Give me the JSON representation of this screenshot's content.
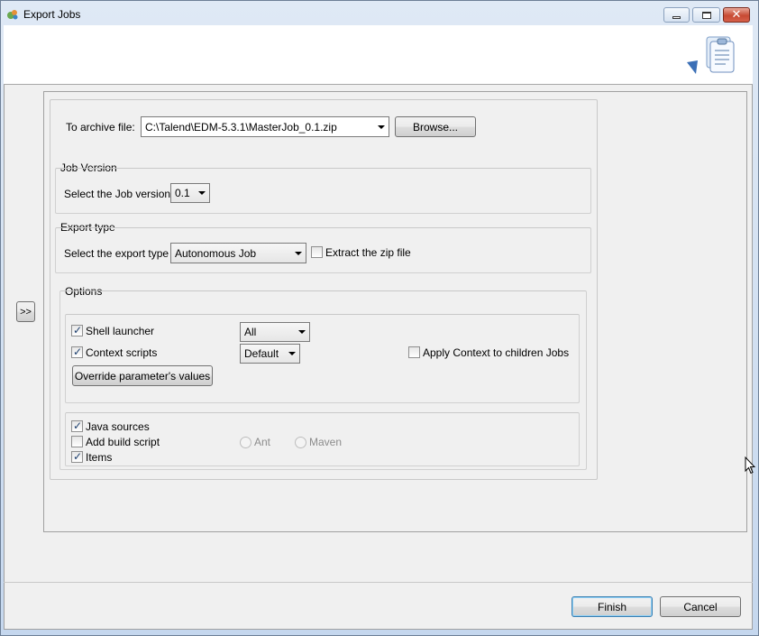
{
  "window": {
    "title": "Export Jobs"
  },
  "archive": {
    "label": "To archive file:",
    "path": "C:\\Talend\\EDM-5.3.1\\MasterJob_0.1.zip",
    "browse_label": "Browse..."
  },
  "job_version": {
    "group_title": "Job Version",
    "label": "Select the Job version",
    "value": "0.1"
  },
  "export_type": {
    "group_title": "Export type",
    "label": "Select the export type",
    "value": "Autonomous Job",
    "extract_label": "Extract the zip file",
    "extract_checked": false
  },
  "options": {
    "group_title": "Options",
    "shell_launcher_label": "Shell launcher",
    "shell_launcher_checked": true,
    "shell_launcher_value": "All",
    "context_scripts_label": "Context scripts",
    "context_scripts_checked": true,
    "context_scripts_value": "Default",
    "apply_context_label": "Apply Context to children Jobs",
    "apply_context_checked": false,
    "override_label": "Override parameter's values",
    "java_sources_label": "Java sources",
    "java_sources_checked": true,
    "add_build_script_label": "Add build script",
    "add_build_script_checked": false,
    "ant_label": "Ant",
    "maven_label": "Maven",
    "items_label": "Items",
    "items_checked": true
  },
  "side": {
    "expand_label": ">>"
  },
  "footer": {
    "finish_label": "Finish",
    "cancel_label": "Cancel"
  },
  "icons": {
    "app": "talend-app-icon",
    "wizard": "export-wizard-icon",
    "cursor": "mouse-pointer-icon"
  }
}
